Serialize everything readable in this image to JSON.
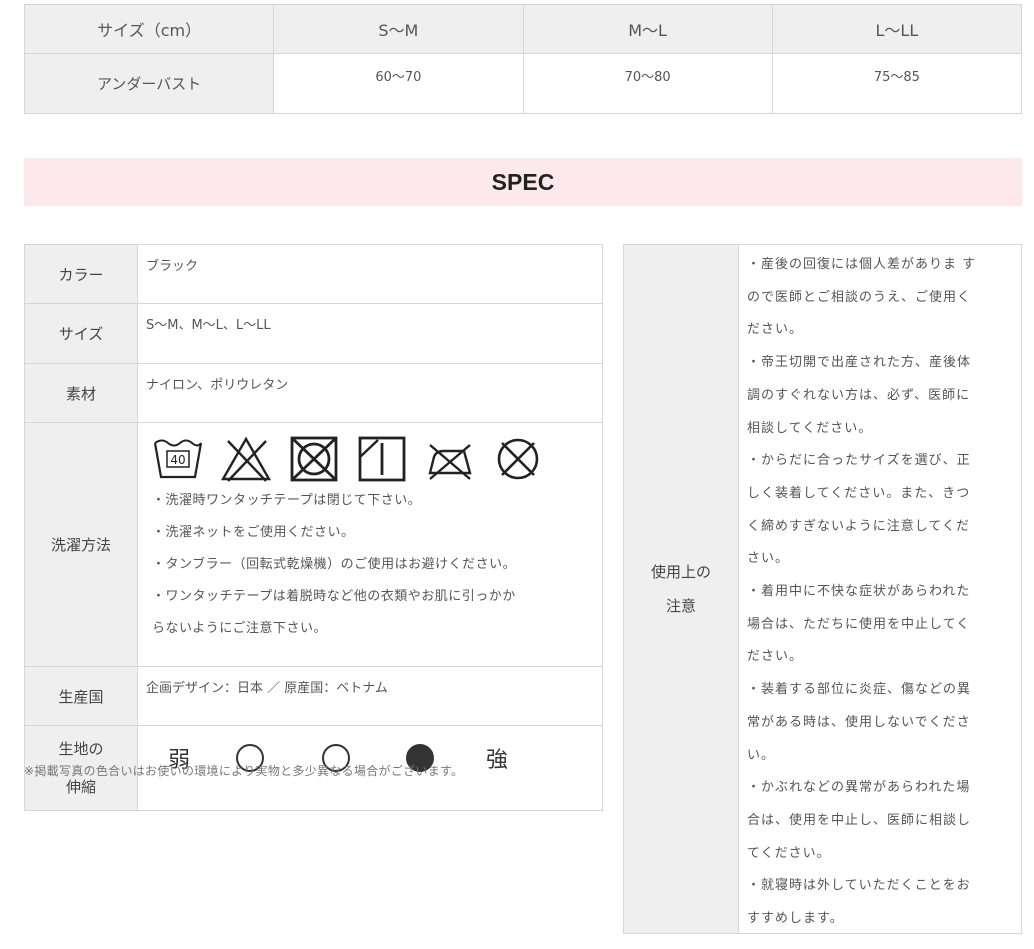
{
  "size_table": {
    "header": [
      "サイズ（cm）",
      "S～M",
      "M～L",
      "L～LL"
    ],
    "row": [
      "アンダーバスト",
      "60～70",
      "70～80",
      "75～85"
    ]
  },
  "spec_title": "SPEC",
  "spec": {
    "color_label": "カラー",
    "color_value": "ブラック",
    "size_label": "サイズ",
    "size_value": "S～M、M～L、L～LL",
    "material_label": "素材",
    "material_value": "ナイロン、ポリウレタン",
    "wash_label": "洗濯方法",
    "wash_icons": [
      "wash-40-icon",
      "no-bleach-icon",
      "no-tumble-dry-icon",
      "line-dry-icon",
      "no-iron-icon",
      "no-dry-clean-icon"
    ],
    "wash_notes": [
      "・洗濯時ワンタッチテープは閉じて下さい。",
      "・洗濯ネットをご使用ください。",
      "・タンブラー（回転式乾燥機）のご使用はお避けください。",
      "・ワンタッチテープは着脱時など他の衣類やお肌に引っかか",
      "らないようにご注意下さい。"
    ],
    "origin_label": "生産国",
    "origin_value": "企画デザイン：日本 ／ 原産国：ベトナム",
    "stretch_label_1": "生地の",
    "stretch_label_2": "伸縮",
    "stretch_weak": "弱",
    "stretch_strong": "強",
    "stretch_level": 3,
    "stretch_levels_total": 3
  },
  "footnote": "※掲載写真の色合いはお使いの環境により実物と多少異なる場合がございます。",
  "caution": {
    "label_1": "使用上の",
    "label_2": "注意",
    "lines": [
      "・産後の回復には個人差がありま す",
      "ので医師とご相談のうえ、ご使用く",
      "ださい。",
      "・帝王切開で出産された方、産後体",
      "調のすぐれない方は、必ず、医師に",
      "相談してください。",
      "・からだに合ったサイズを選び、正",
      "しく装着してください。また、きつ",
      "く締めすぎないように注意してくだ",
      "さい。",
      "・着用中に不快な症状があらわれた",
      "場合は、ただちに使用を中止してく",
      "ださい。",
      "・装着する部位に炎症、傷などの異",
      "常がある時は、使用しないでくださ",
      "い。",
      "・かぶれなどの異常があらわれた場",
      "合は、使用を中止し、医師に相談し",
      "てください。",
      "・就寝時は外していただくことをお",
      "すすめします。"
    ]
  }
}
